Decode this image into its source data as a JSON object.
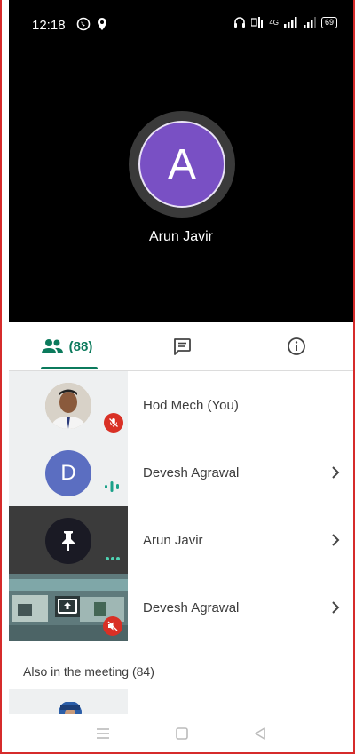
{
  "status_bar": {
    "time": "12:18",
    "network_label": "4G",
    "battery": "69"
  },
  "presenter": {
    "initial": "A",
    "name": "Arun Javir",
    "avatar_color": "#7950c4"
  },
  "tabs": {
    "people_count": "(88)",
    "active": "people",
    "accent": "#0b7a5c"
  },
  "participants": [
    {
      "name": "Hod Mech (You)",
      "status": "muted"
    },
    {
      "name": "Devesh Agrawal",
      "initial": "D",
      "status": "speaking"
    },
    {
      "name": "Arun Javir",
      "status": "pinned"
    },
    {
      "name": "Devesh Agrawal",
      "status": "presenting-muted"
    }
  ],
  "also_in_meeting": "Also in the meeting (84)"
}
